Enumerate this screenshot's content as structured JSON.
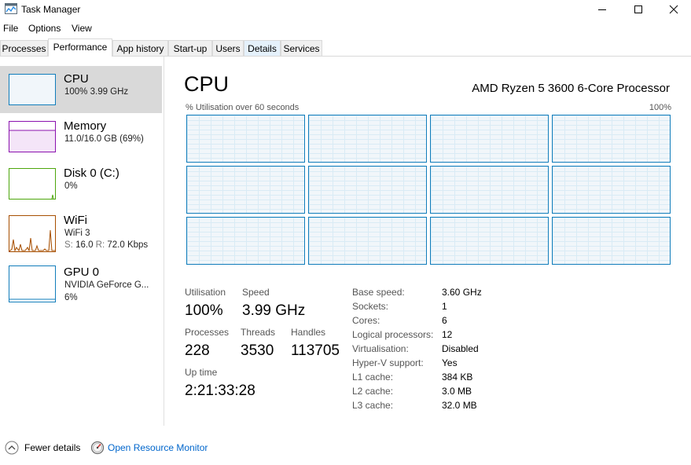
{
  "window": {
    "title": "Task Manager"
  },
  "menu": [
    "File",
    "Options",
    "View"
  ],
  "tabs": [
    "Processes",
    "Performance",
    "App history",
    "Start-up",
    "Users",
    "Details",
    "Services"
  ],
  "sidebar": {
    "items": [
      {
        "name": "CPU",
        "sub1": "100%  3.99 GHz",
        "color": "#117dbb"
      },
      {
        "name": "Memory",
        "sub1": "11.0/16.0 GB (69%)",
        "color": "#8b12ae"
      },
      {
        "name": "Disk 0 (C:)",
        "sub1": "0%",
        "color": "#4da60c"
      },
      {
        "name": "WiFi",
        "sub1": "WiFi 3",
        "sub2_s_label": "S:",
        "sub2_s_value": "16.0",
        "sub2_r_label": "R:",
        "sub2_r_value": "72.0 Kbps",
        "color": "#a74f01"
      },
      {
        "name": "GPU 0",
        "sub1": "NVIDIA GeForce G...",
        "sub2": "6%",
        "color": "#117dbb"
      }
    ]
  },
  "main": {
    "title": "CPU",
    "model": "AMD Ryzen 5 3600 6-Core Processor",
    "graph_label": "% Utilisation over 60 seconds",
    "graph_max": "100%",
    "stats": {
      "utilisation_label": "Utilisation",
      "utilisation": "100%",
      "speed_label": "Speed",
      "speed": "3.99 GHz",
      "processes_label": "Processes",
      "processes": "228",
      "threads_label": "Threads",
      "threads": "3530",
      "handles_label": "Handles",
      "handles": "113705",
      "uptime_label": "Up time",
      "uptime": "2:21:33:28"
    },
    "details": [
      {
        "label": "Base speed:",
        "value": "3.60 GHz"
      },
      {
        "label": "Sockets:",
        "value": "1"
      },
      {
        "label": "Cores:",
        "value": "6"
      },
      {
        "label": "Logical processors:",
        "value": "12"
      },
      {
        "label": "Virtualisation:",
        "value": "Disabled"
      },
      {
        "label": "Hyper-V support:",
        "value": "Yes"
      },
      {
        "label": "L1 cache:",
        "value": "384 KB"
      },
      {
        "label": "L2 cache:",
        "value": "3.0 MB"
      },
      {
        "label": "L3 cache:",
        "value": "32.0 MB"
      }
    ]
  },
  "footer": {
    "fewer_details": "Fewer details",
    "open_monitor": "Open Resource Monitor"
  }
}
